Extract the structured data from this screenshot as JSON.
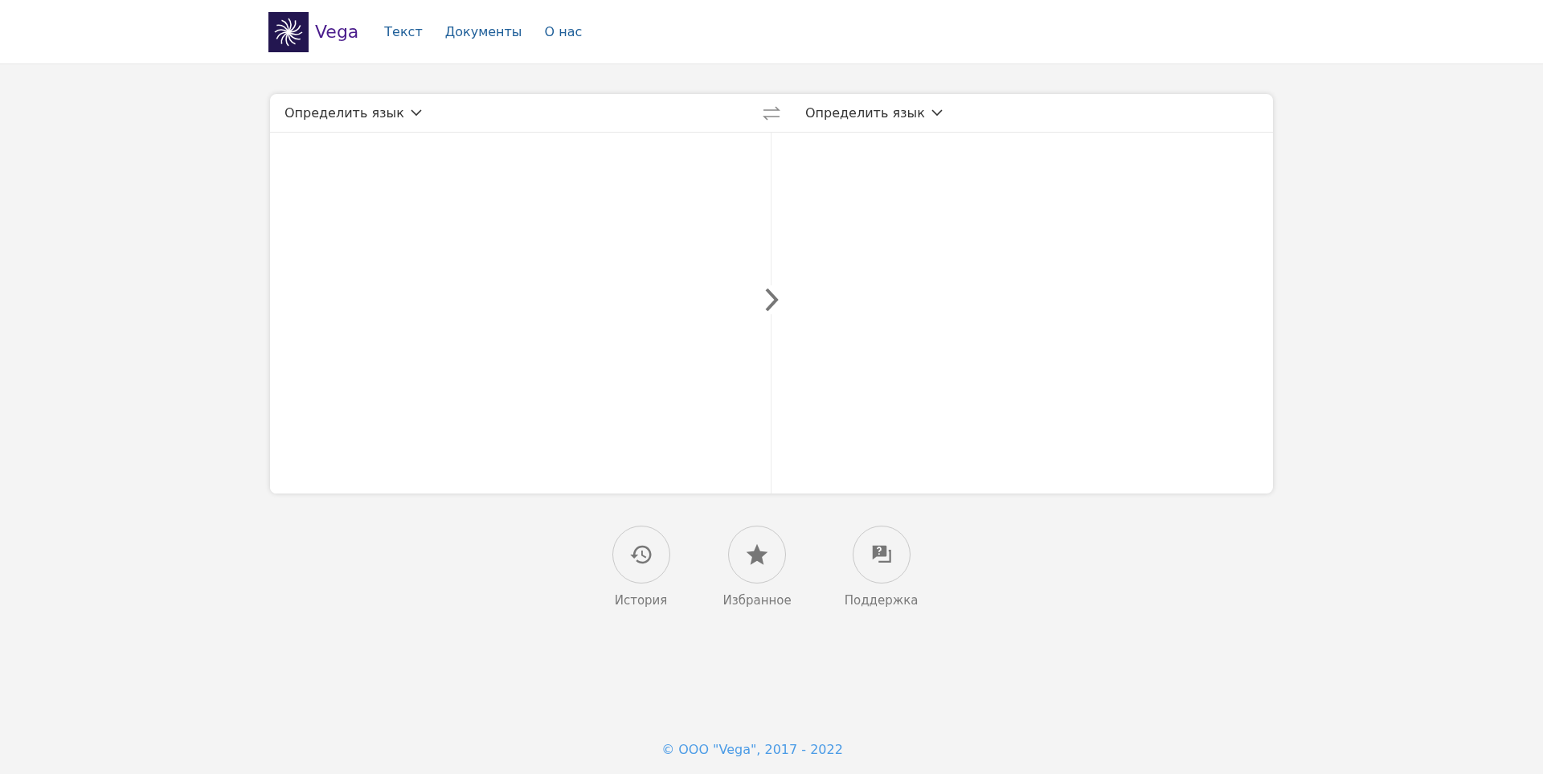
{
  "header": {
    "brand": "Vega",
    "nav": [
      {
        "label": "Текст"
      },
      {
        "label": "Документы"
      },
      {
        "label": "О нас"
      }
    ]
  },
  "translator": {
    "source_language": "Определить язык",
    "target_language": "Определить язык"
  },
  "actions": [
    {
      "kind": "history",
      "label": "История"
    },
    {
      "kind": "favorites",
      "label": "Избранное"
    },
    {
      "kind": "support",
      "label": "Поддержка"
    }
  ],
  "footer": "© ООО \"Vega\", 2017 - 2022"
}
